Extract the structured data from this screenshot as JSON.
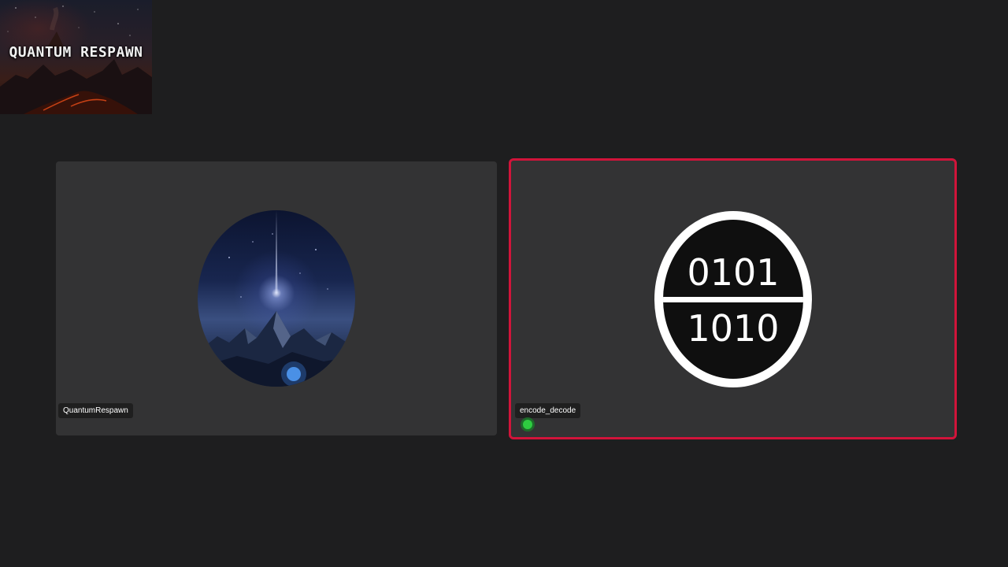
{
  "overlay": {
    "logo_text": "QUANTUM RESPAWN"
  },
  "participants": [
    {
      "name": "QuantumRespawn",
      "avatar": "mountain-starburst-avatar",
      "speaking": false
    },
    {
      "name": "encode_decode",
      "avatar": "binary-code-avatar",
      "avatar_text_top": "0101",
      "avatar_text_bottom": "1010",
      "speaking": true
    }
  ],
  "colors": {
    "background": "#1e1e1f",
    "tile": "#333334",
    "speaking_border": "#d1143a",
    "speaking_indicator": "#2ecc40"
  }
}
